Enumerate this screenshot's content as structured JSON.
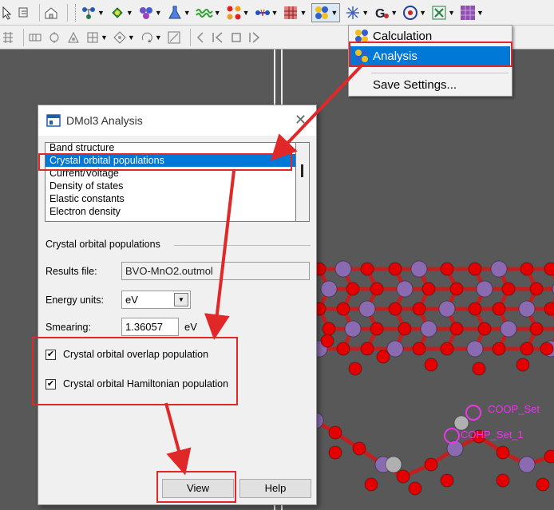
{
  "toolbar": {
    "icons": [
      "bond-icon",
      "fragment-icon",
      "cluster-icon",
      "flask-icon",
      "wave-icon",
      "crystal-icon",
      "transition-icon",
      "grid-icon",
      "module-icon",
      "arrows-icon",
      "g-icon",
      "target-icon",
      "matrix-icon",
      "texture-icon"
    ]
  },
  "menu": {
    "items": [
      {
        "label": "Calculation",
        "selected": false
      },
      {
        "label": "Analysis",
        "selected": true
      },
      {
        "label": "Save Settings...",
        "selected": false
      }
    ]
  },
  "dialog": {
    "title": "DMol3 Analysis",
    "list_items": [
      "Band structure",
      "Crystal orbital populations",
      "Current/Voltage",
      "Density of states",
      "Elastic constants",
      "Electron density"
    ],
    "selected_index": 1,
    "group_title": "Crystal orbital populations",
    "results_file_label": "Results file:",
    "results_file_value": "BVO-MnO2.outmol",
    "energy_units_label": "Energy units:",
    "energy_units_value": "eV",
    "smearing_label": "Smearing:",
    "smearing_value": "1.36057",
    "smearing_unit": "eV",
    "checkbox_coop_label": "Crystal orbital overlap population",
    "checkbox_coop_checked": true,
    "checkbox_cohp_label": "Crystal orbital Hamiltonian population",
    "checkbox_cohp_checked": true,
    "view_label": "View",
    "help_label": "Help"
  },
  "viewport": {
    "labels": [
      "COOP_Set",
      "COHP_Set_1"
    ]
  },
  "colors": {
    "selection": "#0078d7",
    "annotation_red": "#e02828",
    "oxygen_red": "#e30000",
    "metal_purple": "#8a6ab0",
    "label_magenta": "#e838e8"
  }
}
